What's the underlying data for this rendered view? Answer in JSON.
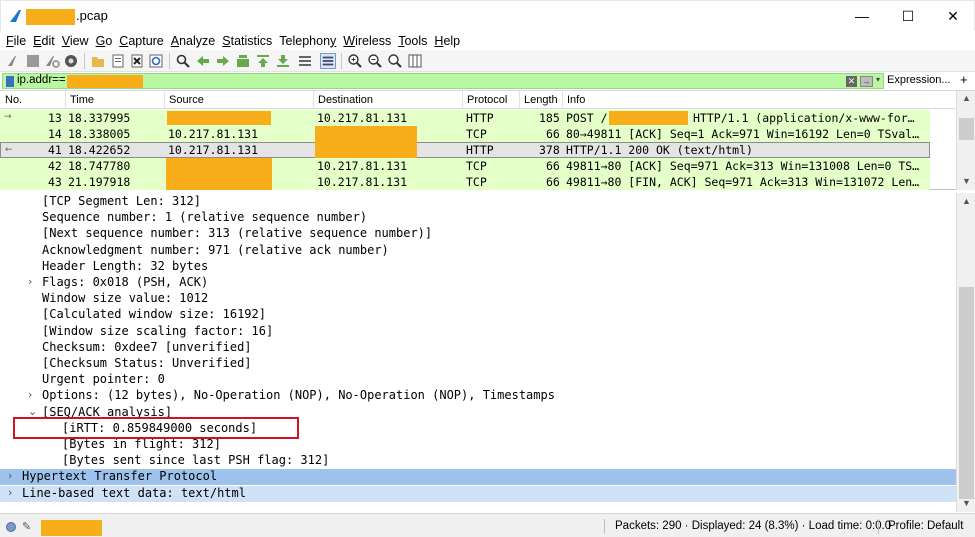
{
  "window": {
    "title": ".pcap",
    "minimize_glyph": "—",
    "maximize_glyph": "☐",
    "close_glyph": "✕"
  },
  "menu": [
    {
      "u": "F",
      "rest": "ile"
    },
    {
      "u": "E",
      "rest": "dit"
    },
    {
      "u": "V",
      "rest": "iew"
    },
    {
      "u": "G",
      "rest": "o"
    },
    {
      "u": "C",
      "rest": "apture"
    },
    {
      "u": "A",
      "rest": "nalyze"
    },
    {
      "u": "S",
      "rest": "tatistics"
    },
    {
      "u": "",
      "rest": "Telephon",
      "u2": "y"
    },
    {
      "u": "W",
      "rest": "ireless"
    },
    {
      "u": "T",
      "rest": "ools"
    },
    {
      "u": "H",
      "rest": "elp"
    }
  ],
  "toolbar_icons": [
    "start-capture-icon",
    "stop-capture-icon",
    "restart-capture-icon",
    "capture-options-icon",
    "open-file-icon",
    "save-file-icon",
    "close-file-icon",
    "reload-file-icon",
    "find-packet-icon",
    "go-back-icon",
    "go-forward-icon",
    "go-to-packet-icon",
    "go-first-icon",
    "go-last-icon",
    "auto-scroll-icon",
    "colorize-icon",
    "zoom-in-icon",
    "zoom-out-icon",
    "zoom-normal-icon",
    "resize-columns-icon"
  ],
  "filter": {
    "text": "ip.addr==",
    "expression_label": "Expression...",
    "add_label": "+"
  },
  "packet_list": {
    "columns": [
      "No.",
      "Time",
      "Source",
      "Destination",
      "Protocol",
      "Length",
      "Info"
    ],
    "rows": [
      {
        "no": "13",
        "time": "18.337995",
        "source": "",
        "destination": "10.217.81.131",
        "protocol": "HTTP",
        "length": "185",
        "info_pre": "POST /",
        "info_post": "HTTP/1.1  (application/x-www-for…",
        "mark": "→"
      },
      {
        "no": "14",
        "time": "18.338005",
        "source": "10.217.81.131",
        "destination": "",
        "protocol": "TCP",
        "length": "66",
        "info_pre": "80→49811 [ACK] Seq=1 Ack=971 Win=16192 Len=0 TSval…",
        "info_post": "",
        "mark": ""
      },
      {
        "no": "41",
        "time": "18.422652",
        "source": "10.217.81.131",
        "destination": "",
        "protocol": "HTTP",
        "length": "378",
        "info_pre": "HTTP/1.1 200 OK  (text/html)",
        "info_post": "",
        "mark": "←"
      },
      {
        "no": "42",
        "time": "18.747780",
        "source": "",
        "destination": "10.217.81.131",
        "protocol": "TCP",
        "length": "66",
        "info_pre": "49811→80 [ACK] Seq=971 Ack=313 Win=131008 Len=0 TS…",
        "info_post": "",
        "mark": ""
      },
      {
        "no": "43",
        "time": "21.197918",
        "source": "",
        "destination": "10.217.81.131",
        "protocol": "TCP",
        "length": "66",
        "info_pre": "49811→80 [FIN, ACK] Seq=971 Ack=313 Win=131072 Len…",
        "info_post": "",
        "mark": ""
      }
    ]
  },
  "details": [
    {
      "indent": 2,
      "arrow": "",
      "text": "[TCP Segment Len: 312]"
    },
    {
      "indent": 2,
      "arrow": "",
      "text": "Sequence number: 1    (relative sequence number)"
    },
    {
      "indent": 2,
      "arrow": "",
      "text": "[Next sequence number: 313    (relative sequence number)]"
    },
    {
      "indent": 2,
      "arrow": "",
      "text": "Acknowledgment number: 971    (relative ack number)"
    },
    {
      "indent": 2,
      "arrow": "",
      "text": "Header Length: 32 bytes"
    },
    {
      "indent": 2,
      "arrow": "›",
      "text": "Flags: 0x018 (PSH, ACK)"
    },
    {
      "indent": 2,
      "arrow": "",
      "text": "Window size value: 1012"
    },
    {
      "indent": 2,
      "arrow": "",
      "text": "[Calculated window size: 16192]"
    },
    {
      "indent": 2,
      "arrow": "",
      "text": "[Window size scaling factor: 16]"
    },
    {
      "indent": 2,
      "arrow": "",
      "text": "Checksum: 0xdee7 [unverified]"
    },
    {
      "indent": 2,
      "arrow": "",
      "text": "[Checksum Status: Unverified]"
    },
    {
      "indent": 2,
      "arrow": "",
      "text": "Urgent pointer: 0"
    },
    {
      "indent": 2,
      "arrow": "›",
      "text": "Options: (12 bytes), No-Operation (NOP), No-Operation (NOP), Timestamps"
    },
    {
      "indent": 2,
      "arrow": "⌄",
      "text": "[SEQ/ACK analysis]"
    },
    {
      "indent": 3,
      "arrow": "",
      "text": "[iRTT: 0.859849000 seconds]"
    },
    {
      "indent": 3,
      "arrow": "",
      "text": "[Bytes in flight: 312]"
    },
    {
      "indent": 3,
      "arrow": "",
      "text": "[Bytes sent since last PSH flag: 312]"
    },
    {
      "indent": 1,
      "arrow": "›",
      "text": "Hypertext Transfer Protocol",
      "highlight": "strong"
    },
    {
      "indent": 1,
      "arrow": "›",
      "text": "Line-based text data: text/html",
      "highlight": "light"
    }
  ],
  "status": {
    "packets": "Packets: 290 · Displayed: 24 (8.3%) · Load time: 0:0.0",
    "profile": "Profile: Default"
  },
  "colors": {
    "redaction": "#f7ae1a",
    "filter_valid": "#b9f7a0",
    "row_green": "#e4ffc7",
    "highlight_box": "#d40f25"
  }
}
